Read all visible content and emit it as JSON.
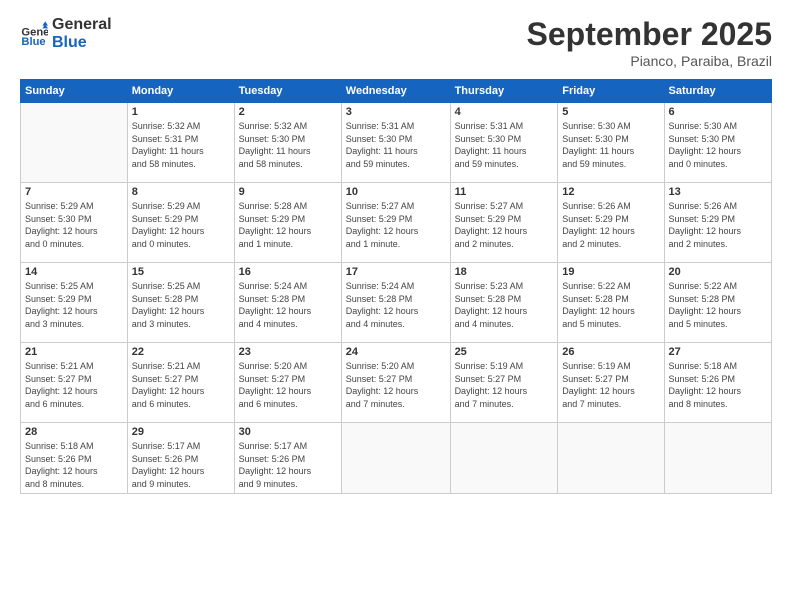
{
  "logo": {
    "line1": "General",
    "line2": "Blue"
  },
  "title": "September 2025",
  "subtitle": "Pianco, Paraiba, Brazil",
  "days_of_week": [
    "Sunday",
    "Monday",
    "Tuesday",
    "Wednesday",
    "Thursday",
    "Friday",
    "Saturday"
  ],
  "weeks": [
    [
      {
        "day": "",
        "info": ""
      },
      {
        "day": "1",
        "info": "Sunrise: 5:32 AM\nSunset: 5:31 PM\nDaylight: 11 hours\nand 58 minutes."
      },
      {
        "day": "2",
        "info": "Sunrise: 5:32 AM\nSunset: 5:30 PM\nDaylight: 11 hours\nand 58 minutes."
      },
      {
        "day": "3",
        "info": "Sunrise: 5:31 AM\nSunset: 5:30 PM\nDaylight: 11 hours\nand 59 minutes."
      },
      {
        "day": "4",
        "info": "Sunrise: 5:31 AM\nSunset: 5:30 PM\nDaylight: 11 hours\nand 59 minutes."
      },
      {
        "day": "5",
        "info": "Sunrise: 5:30 AM\nSunset: 5:30 PM\nDaylight: 11 hours\nand 59 minutes."
      },
      {
        "day": "6",
        "info": "Sunrise: 5:30 AM\nSunset: 5:30 PM\nDaylight: 12 hours\nand 0 minutes."
      }
    ],
    [
      {
        "day": "7",
        "info": "Sunrise: 5:29 AM\nSunset: 5:30 PM\nDaylight: 12 hours\nand 0 minutes."
      },
      {
        "day": "8",
        "info": "Sunrise: 5:29 AM\nSunset: 5:29 PM\nDaylight: 12 hours\nand 0 minutes."
      },
      {
        "day": "9",
        "info": "Sunrise: 5:28 AM\nSunset: 5:29 PM\nDaylight: 12 hours\nand 1 minute."
      },
      {
        "day": "10",
        "info": "Sunrise: 5:27 AM\nSunset: 5:29 PM\nDaylight: 12 hours\nand 1 minute."
      },
      {
        "day": "11",
        "info": "Sunrise: 5:27 AM\nSunset: 5:29 PM\nDaylight: 12 hours\nand 2 minutes."
      },
      {
        "day": "12",
        "info": "Sunrise: 5:26 AM\nSunset: 5:29 PM\nDaylight: 12 hours\nand 2 minutes."
      },
      {
        "day": "13",
        "info": "Sunrise: 5:26 AM\nSunset: 5:29 PM\nDaylight: 12 hours\nand 2 minutes."
      }
    ],
    [
      {
        "day": "14",
        "info": "Sunrise: 5:25 AM\nSunset: 5:29 PM\nDaylight: 12 hours\nand 3 minutes."
      },
      {
        "day": "15",
        "info": "Sunrise: 5:25 AM\nSunset: 5:28 PM\nDaylight: 12 hours\nand 3 minutes."
      },
      {
        "day": "16",
        "info": "Sunrise: 5:24 AM\nSunset: 5:28 PM\nDaylight: 12 hours\nand 4 minutes."
      },
      {
        "day": "17",
        "info": "Sunrise: 5:24 AM\nSunset: 5:28 PM\nDaylight: 12 hours\nand 4 minutes."
      },
      {
        "day": "18",
        "info": "Sunrise: 5:23 AM\nSunset: 5:28 PM\nDaylight: 12 hours\nand 4 minutes."
      },
      {
        "day": "19",
        "info": "Sunrise: 5:22 AM\nSunset: 5:28 PM\nDaylight: 12 hours\nand 5 minutes."
      },
      {
        "day": "20",
        "info": "Sunrise: 5:22 AM\nSunset: 5:28 PM\nDaylight: 12 hours\nand 5 minutes."
      }
    ],
    [
      {
        "day": "21",
        "info": "Sunrise: 5:21 AM\nSunset: 5:27 PM\nDaylight: 12 hours\nand 6 minutes."
      },
      {
        "day": "22",
        "info": "Sunrise: 5:21 AM\nSunset: 5:27 PM\nDaylight: 12 hours\nand 6 minutes."
      },
      {
        "day": "23",
        "info": "Sunrise: 5:20 AM\nSunset: 5:27 PM\nDaylight: 12 hours\nand 6 minutes."
      },
      {
        "day": "24",
        "info": "Sunrise: 5:20 AM\nSunset: 5:27 PM\nDaylight: 12 hours\nand 7 minutes."
      },
      {
        "day": "25",
        "info": "Sunrise: 5:19 AM\nSunset: 5:27 PM\nDaylight: 12 hours\nand 7 minutes."
      },
      {
        "day": "26",
        "info": "Sunrise: 5:19 AM\nSunset: 5:27 PM\nDaylight: 12 hours\nand 7 minutes."
      },
      {
        "day": "27",
        "info": "Sunrise: 5:18 AM\nSunset: 5:26 PM\nDaylight: 12 hours\nand 8 minutes."
      }
    ],
    [
      {
        "day": "28",
        "info": "Sunrise: 5:18 AM\nSunset: 5:26 PM\nDaylight: 12 hours\nand 8 minutes."
      },
      {
        "day": "29",
        "info": "Sunrise: 5:17 AM\nSunset: 5:26 PM\nDaylight: 12 hours\nand 9 minutes."
      },
      {
        "day": "30",
        "info": "Sunrise: 5:17 AM\nSunset: 5:26 PM\nDaylight: 12 hours\nand 9 minutes."
      },
      {
        "day": "",
        "info": ""
      },
      {
        "day": "",
        "info": ""
      },
      {
        "day": "",
        "info": ""
      },
      {
        "day": "",
        "info": ""
      }
    ]
  ]
}
